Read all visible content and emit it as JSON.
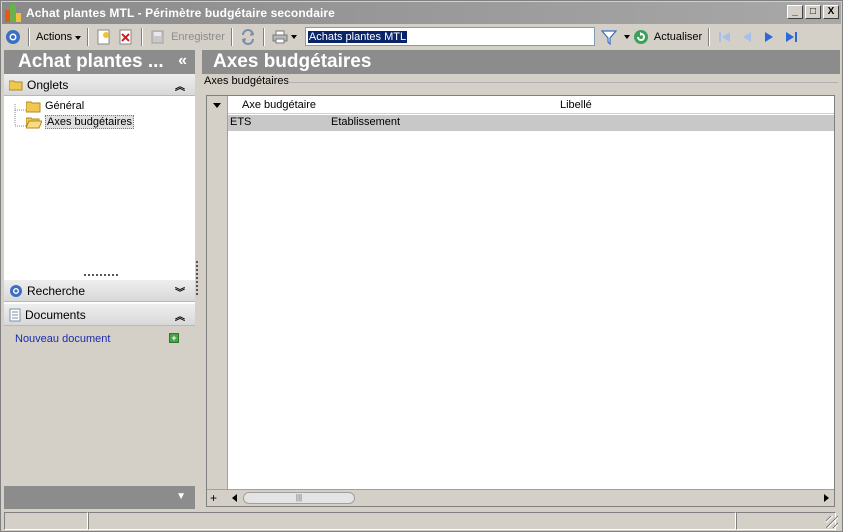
{
  "window": {
    "title": "Achat plantes MTL -  Périmètre budgétaire secondaire",
    "buttons": [
      "_",
      "□",
      "X"
    ]
  },
  "toolbar": {
    "actions_label": "Actions",
    "save_label": "Enregistrer",
    "search_value": "Achats plantes MTL",
    "refresh_label": "Actualiser"
  },
  "left_panel": {
    "header": "Achat plantes ...",
    "collapse_glyph": "«",
    "tabs_section": "Onglets",
    "tree": [
      {
        "label": "Général"
      },
      {
        "label": "Axes budgétaires",
        "selected": true
      }
    ],
    "search_section": "Recherche",
    "documents_section": "Documents",
    "new_document": "Nouveau document"
  },
  "right_panel": {
    "header": "Axes budgétaires",
    "group_label": "Axes budgétaires",
    "columns": [
      "Axe budgétaire",
      "Libellé"
    ],
    "rows": [
      {
        "code": "ETS",
        "label": "Etablissement"
      }
    ],
    "add_row_glyph": "+",
    "scroll_thumb_grip": "|||"
  },
  "colors": {
    "panel_header": "#8c8c8c",
    "selection": "#0a246a",
    "link": "#1a2cb0",
    "row_highlight": "#c8c8c8"
  }
}
